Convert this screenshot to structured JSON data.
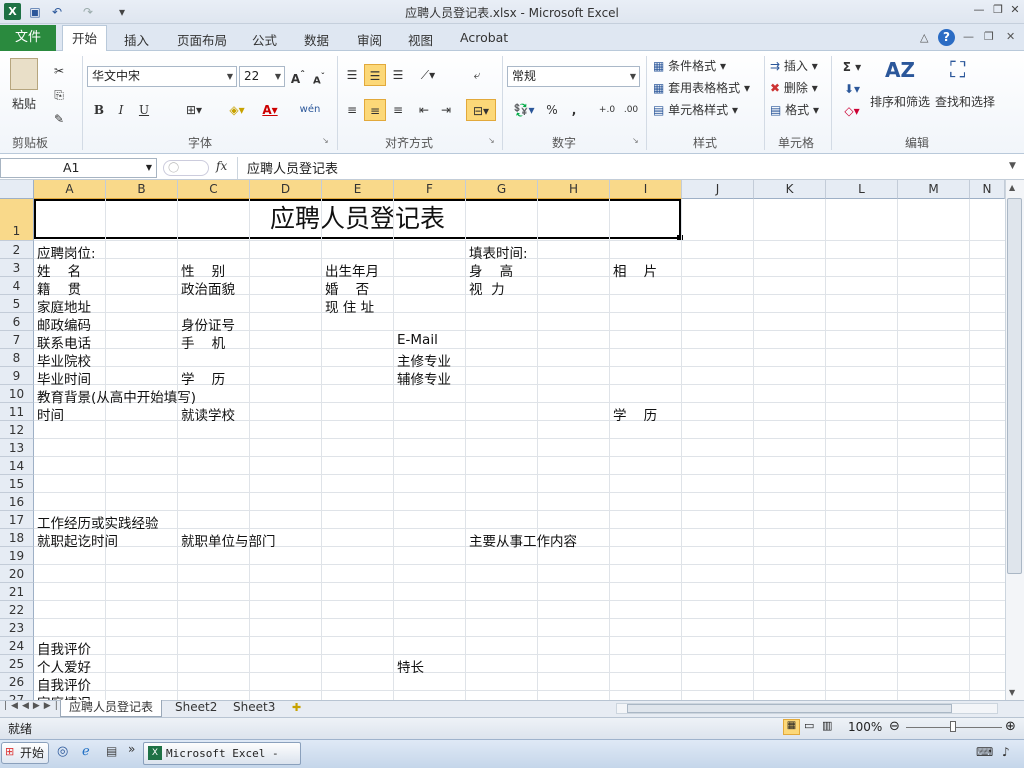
{
  "window": {
    "title": "应聘人员登记表.xlsx - Microsoft Excel",
    "app_icon": "X"
  },
  "ribbon_tabs": {
    "file": "文件",
    "tabs": [
      "开始",
      "插入",
      "页面布局",
      "公式",
      "数据",
      "审阅",
      "视图",
      "Acrobat"
    ]
  },
  "ribbon": {
    "paste": "粘贴",
    "font_name": "华文中宋",
    "font_size": "22",
    "number_format": "常规",
    "conditional": "条件格式",
    "table_style": "套用表格格式",
    "cell_style": "单元格样式",
    "insert": "插入",
    "delete": "删除",
    "format": "格式",
    "sort_filter": "排序和筛选",
    "find_select": "查找和选择",
    "groups": [
      "剪贴板",
      "字体",
      "对齐方式",
      "数字",
      "样式",
      "单元格",
      "编辑"
    ],
    "bold": "B",
    "italic": "I",
    "underline": "U",
    "percent": "%",
    "comma": ",",
    "sigma": "Σ",
    "wen": "wén"
  },
  "formula_bar": {
    "name_box": "A1",
    "fx": "fx",
    "value": "应聘人员登记表"
  },
  "columns": [
    "A",
    "B",
    "C",
    "D",
    "E",
    "F",
    "G",
    "H",
    "I",
    "J",
    "K",
    "L",
    "M",
    "N"
  ],
  "rows": [
    "1",
    "2",
    "3",
    "4",
    "5",
    "6",
    "7",
    "8",
    "9",
    "10",
    "11",
    "12",
    "13",
    "14",
    "15",
    "16",
    "17",
    "18",
    "19",
    "20",
    "21",
    "22",
    "23",
    "24",
    "25",
    "26",
    "27"
  ],
  "cells": {
    "title": "应聘人员登记表",
    "r2a": "应聘岗位:",
    "r2g": "填表时间:",
    "r3a": "姓    名",
    "r3c": "性    别",
    "r3e": "出生年月",
    "r3g": "身    高",
    "r3i": "相    片",
    "r4a": "籍    贯",
    "r4c": "政治面貌",
    "r4e": "婚    否",
    "r4g": "视  力",
    "r5a": "家庭地址",
    "r5e": "现 住 址",
    "r6a": "邮政编码",
    "r6c": "身份证号",
    "r7a": "联系电话",
    "r7c": "手    机",
    "r7f": "E-Mail",
    "r8a": "毕业院校",
    "r8f": "主修专业",
    "r9a": "毕业时间",
    "r9c": "学    历",
    "r9f": "辅修专业",
    "r10a": "教育背景(从高中开始填写)",
    "r11a": "时间",
    "r11c": "就读学校",
    "r11i": "学    历",
    "r17a": "工作经历或实践经验",
    "r18a": "就职起讫时间",
    "r18c": "就职单位与部门",
    "r18g": "主要从事工作内容",
    "r24a": "自我评价",
    "r25a": "个人爱好",
    "r25f": "特长",
    "r26a": "自我评价",
    "r27a": "家庭情况"
  },
  "sheets": [
    "应聘人员登记表",
    "Sheet2",
    "Sheet3"
  ],
  "status": {
    "ready": "就绪",
    "zoom": "100%"
  },
  "taskbar": {
    "start": "开始",
    "app": "Microsoft Excel - ..."
  }
}
